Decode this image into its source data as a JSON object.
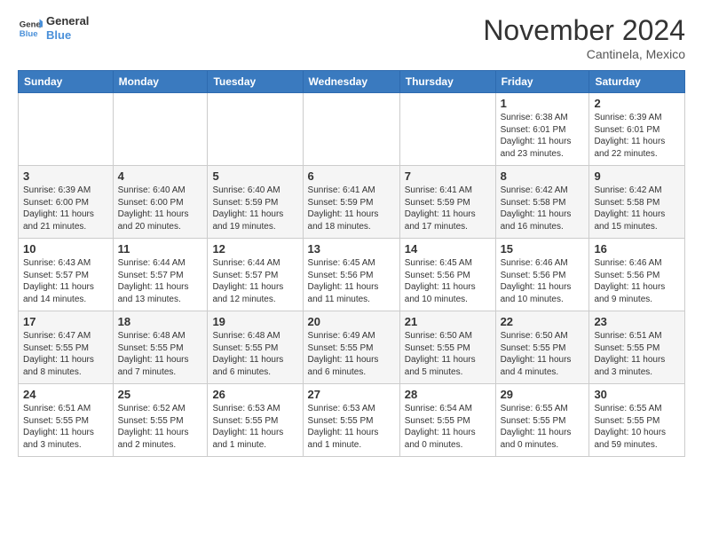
{
  "logo": {
    "line1": "General",
    "line2": "Blue"
  },
  "title": "November 2024",
  "location": "Cantinela, Mexico",
  "days_of_week": [
    "Sunday",
    "Monday",
    "Tuesday",
    "Wednesday",
    "Thursday",
    "Friday",
    "Saturday"
  ],
  "weeks": [
    [
      {
        "day": "",
        "info": ""
      },
      {
        "day": "",
        "info": ""
      },
      {
        "day": "",
        "info": ""
      },
      {
        "day": "",
        "info": ""
      },
      {
        "day": "",
        "info": ""
      },
      {
        "day": "1",
        "info": "Sunrise: 6:38 AM\nSunset: 6:01 PM\nDaylight: 11 hours and 23 minutes."
      },
      {
        "day": "2",
        "info": "Sunrise: 6:39 AM\nSunset: 6:01 PM\nDaylight: 11 hours and 22 minutes."
      }
    ],
    [
      {
        "day": "3",
        "info": "Sunrise: 6:39 AM\nSunset: 6:00 PM\nDaylight: 11 hours and 21 minutes."
      },
      {
        "day": "4",
        "info": "Sunrise: 6:40 AM\nSunset: 6:00 PM\nDaylight: 11 hours and 20 minutes."
      },
      {
        "day": "5",
        "info": "Sunrise: 6:40 AM\nSunset: 5:59 PM\nDaylight: 11 hours and 19 minutes."
      },
      {
        "day": "6",
        "info": "Sunrise: 6:41 AM\nSunset: 5:59 PM\nDaylight: 11 hours and 18 minutes."
      },
      {
        "day": "7",
        "info": "Sunrise: 6:41 AM\nSunset: 5:59 PM\nDaylight: 11 hours and 17 minutes."
      },
      {
        "day": "8",
        "info": "Sunrise: 6:42 AM\nSunset: 5:58 PM\nDaylight: 11 hours and 16 minutes."
      },
      {
        "day": "9",
        "info": "Sunrise: 6:42 AM\nSunset: 5:58 PM\nDaylight: 11 hours and 15 minutes."
      }
    ],
    [
      {
        "day": "10",
        "info": "Sunrise: 6:43 AM\nSunset: 5:57 PM\nDaylight: 11 hours and 14 minutes."
      },
      {
        "day": "11",
        "info": "Sunrise: 6:44 AM\nSunset: 5:57 PM\nDaylight: 11 hours and 13 minutes."
      },
      {
        "day": "12",
        "info": "Sunrise: 6:44 AM\nSunset: 5:57 PM\nDaylight: 11 hours and 12 minutes."
      },
      {
        "day": "13",
        "info": "Sunrise: 6:45 AM\nSunset: 5:56 PM\nDaylight: 11 hours and 11 minutes."
      },
      {
        "day": "14",
        "info": "Sunrise: 6:45 AM\nSunset: 5:56 PM\nDaylight: 11 hours and 10 minutes."
      },
      {
        "day": "15",
        "info": "Sunrise: 6:46 AM\nSunset: 5:56 PM\nDaylight: 11 hours and 10 minutes."
      },
      {
        "day": "16",
        "info": "Sunrise: 6:46 AM\nSunset: 5:56 PM\nDaylight: 11 hours and 9 minutes."
      }
    ],
    [
      {
        "day": "17",
        "info": "Sunrise: 6:47 AM\nSunset: 5:55 PM\nDaylight: 11 hours and 8 minutes."
      },
      {
        "day": "18",
        "info": "Sunrise: 6:48 AM\nSunset: 5:55 PM\nDaylight: 11 hours and 7 minutes."
      },
      {
        "day": "19",
        "info": "Sunrise: 6:48 AM\nSunset: 5:55 PM\nDaylight: 11 hours and 6 minutes."
      },
      {
        "day": "20",
        "info": "Sunrise: 6:49 AM\nSunset: 5:55 PM\nDaylight: 11 hours and 6 minutes."
      },
      {
        "day": "21",
        "info": "Sunrise: 6:50 AM\nSunset: 5:55 PM\nDaylight: 11 hours and 5 minutes."
      },
      {
        "day": "22",
        "info": "Sunrise: 6:50 AM\nSunset: 5:55 PM\nDaylight: 11 hours and 4 minutes."
      },
      {
        "day": "23",
        "info": "Sunrise: 6:51 AM\nSunset: 5:55 PM\nDaylight: 11 hours and 3 minutes."
      }
    ],
    [
      {
        "day": "24",
        "info": "Sunrise: 6:51 AM\nSunset: 5:55 PM\nDaylight: 11 hours and 3 minutes."
      },
      {
        "day": "25",
        "info": "Sunrise: 6:52 AM\nSunset: 5:55 PM\nDaylight: 11 hours and 2 minutes."
      },
      {
        "day": "26",
        "info": "Sunrise: 6:53 AM\nSunset: 5:55 PM\nDaylight: 11 hours and 1 minute."
      },
      {
        "day": "27",
        "info": "Sunrise: 6:53 AM\nSunset: 5:55 PM\nDaylight: 11 hours and 1 minute."
      },
      {
        "day": "28",
        "info": "Sunrise: 6:54 AM\nSunset: 5:55 PM\nDaylight: 11 hours and 0 minutes."
      },
      {
        "day": "29",
        "info": "Sunrise: 6:55 AM\nSunset: 5:55 PM\nDaylight: 11 hours and 0 minutes."
      },
      {
        "day": "30",
        "info": "Sunrise: 6:55 AM\nSunset: 5:55 PM\nDaylight: 10 hours and 59 minutes."
      }
    ]
  ]
}
